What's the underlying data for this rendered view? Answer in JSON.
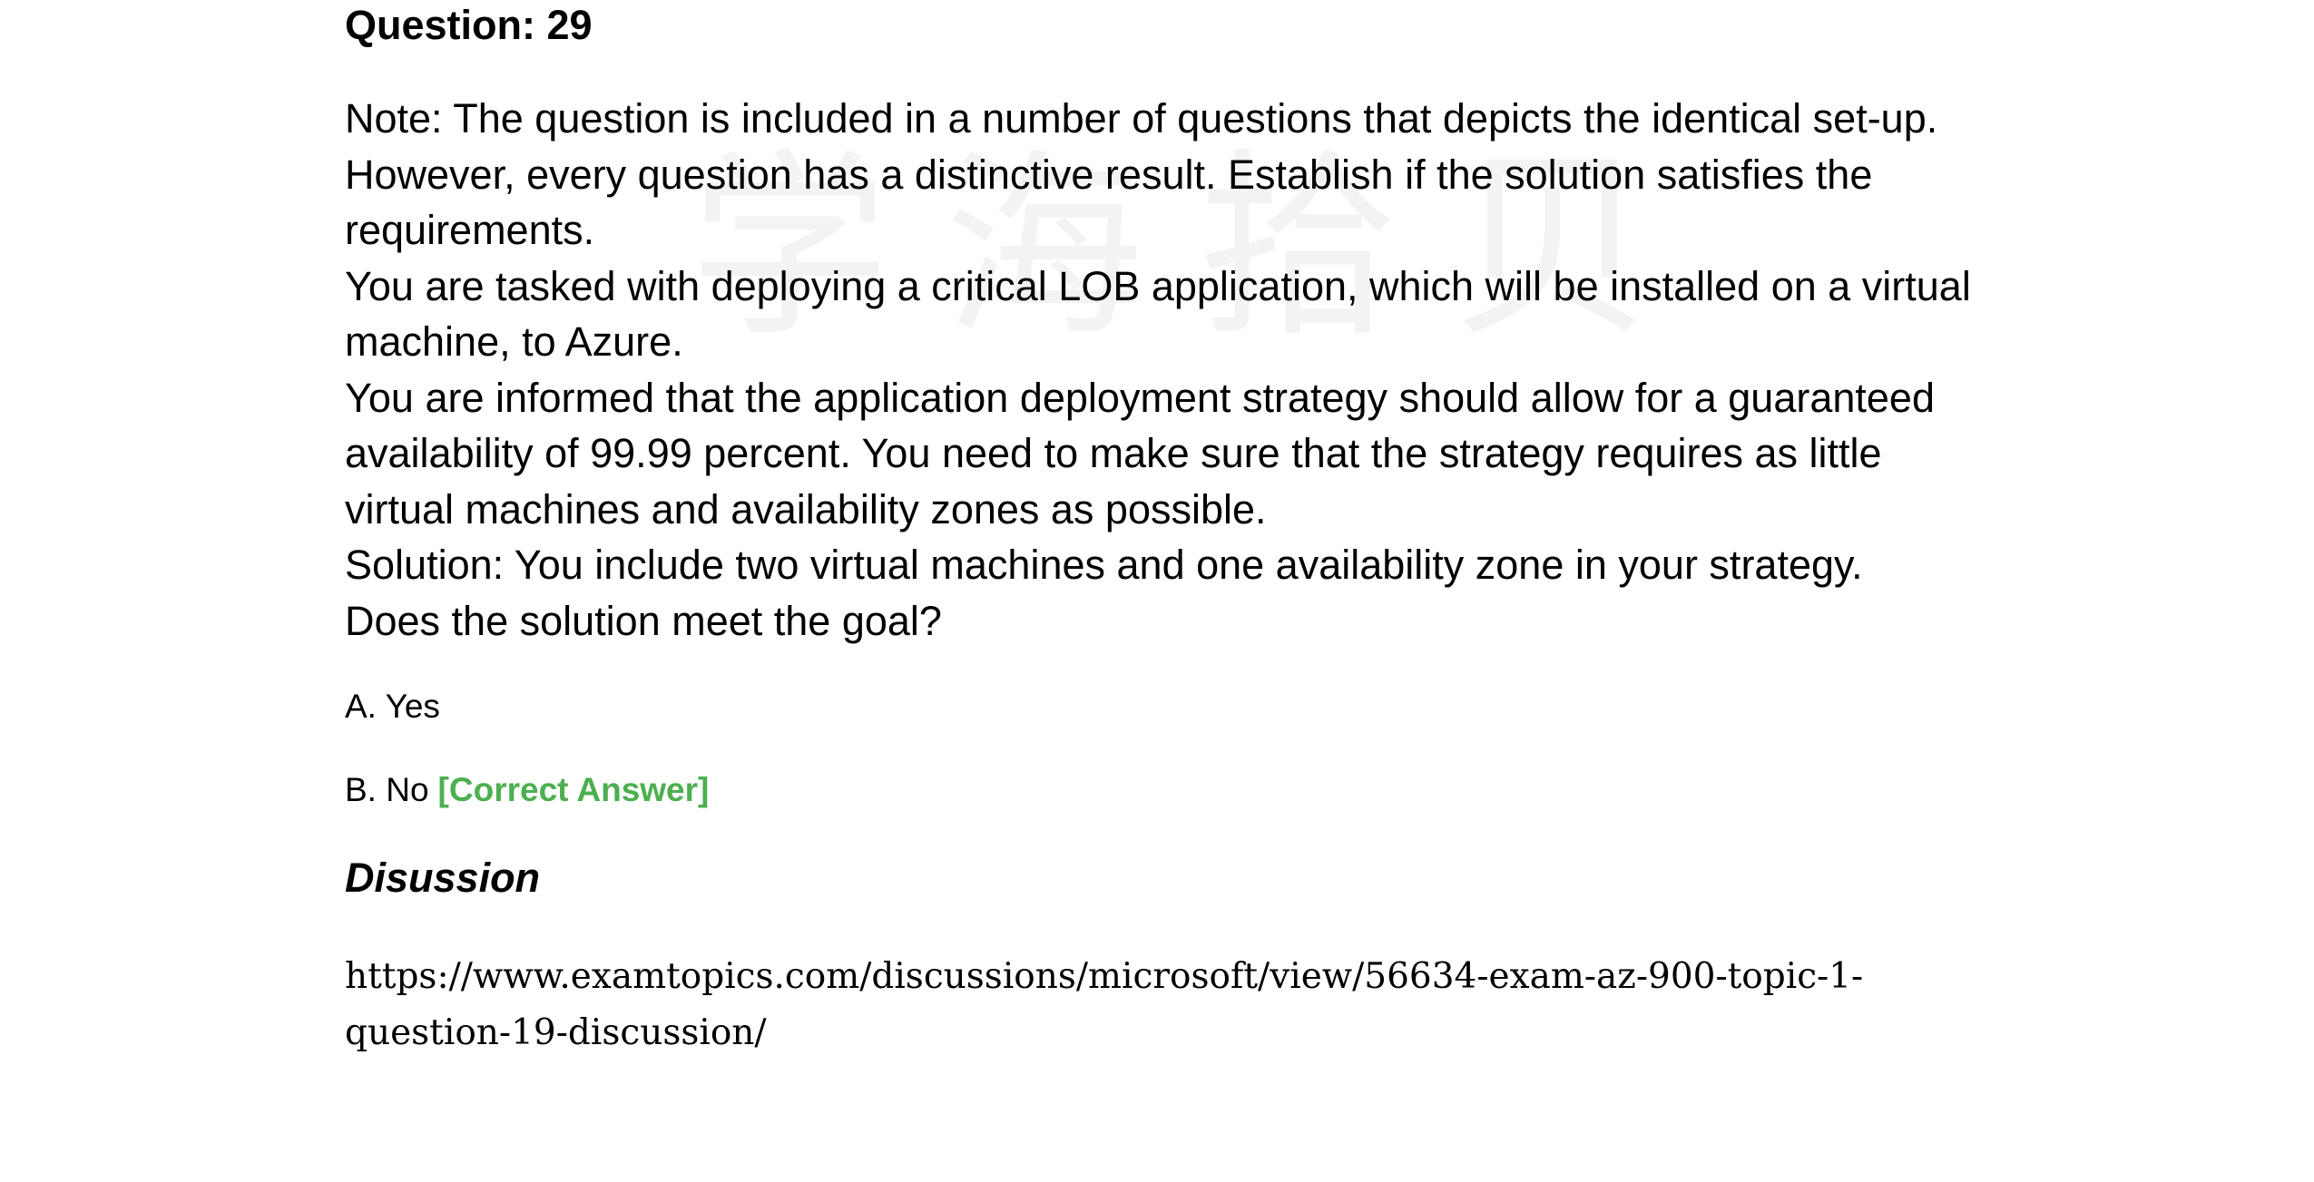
{
  "watermark": "学海拾贝",
  "question": {
    "title": "Question: 29",
    "paragraphs": [
      "Note: The question is included in a number of questions that depicts the identical set-up. However, every question has a distinctive result. Establish if the solution satisfies the requirements.",
      "You are tasked with deploying a critical LOB application, which will be installed on a virtual machine, to Azure.",
      "You are informed that the application deployment strategy should allow for a guaranteed availability of 99.99 percent. You need to make sure that the strategy requires as little virtual machines and availability zones as possible.",
      "Solution: You include two virtual machines and one availability zone in your strategy.",
      "Does the solution meet the goal?"
    ]
  },
  "options": {
    "a": {
      "label": "A. Yes"
    },
    "b": {
      "label": "B. No",
      "tag": "[Correct Answer]"
    }
  },
  "colors": {
    "correct_tag": "#4caf50"
  },
  "discussion": {
    "heading": "Disussion",
    "link": "https://www.examtopics.com/discussions/microsoft/view/56634-exam-az-900-topic-1-question-19-discussion/"
  }
}
